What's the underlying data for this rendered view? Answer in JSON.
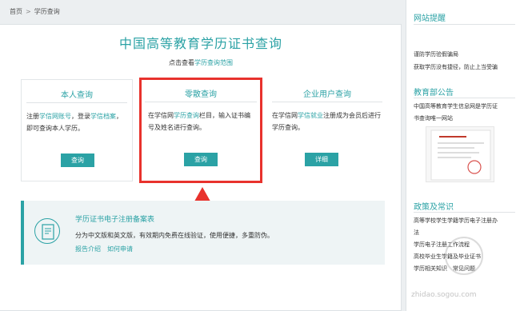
{
  "breadcrumb": {
    "home": "首页",
    "separator": ">",
    "current": "学历查询"
  },
  "main": {
    "title": "中国高等教育学历证书查询",
    "subline_prefix": "点击查看",
    "subline_link": "学历查询范围"
  },
  "cards": [
    {
      "title": "本人查询",
      "desc_parts": [
        "注册",
        "学信网账号",
        "，登录",
        "学信档案",
        "，即可查询本人学历。"
      ],
      "button": "查询"
    },
    {
      "title": "零散查询",
      "desc_parts": [
        "在学信网",
        "学历查询",
        "栏目，输入证书编号及姓名进行查询。"
      ],
      "button": "查询"
    },
    {
      "title": "企业用户查询",
      "desc_parts": [
        "在学信网",
        "学信就业",
        "注册成为会员后进行学历查询。"
      ],
      "button": "详细"
    }
  ],
  "bottom": {
    "title": "学历证书电子注册备案表",
    "desc": "分为中文版和英文版，有效期内免费在线验证，使用便捷，多重防伪。",
    "links": [
      "报告介绍",
      "如何申请"
    ]
  },
  "sidebar": {
    "notice_heading": "网站提醒",
    "notice_items": [
      "谨防学历验假骗局",
      "获取学历没有捷径，防止上当受骗"
    ],
    "announce_heading": "教育部公告",
    "announce_text": [
      "中国高等教育学生信息网是学历证",
      "书查询唯一网站"
    ],
    "policy_heading": "政策及常识",
    "policy_items": [
      "高等学校学生学籍学历电子注册办",
      "法",
      "学历电子注册工作流程",
      "高校毕业生学籍及毕业证书",
      "学历相关知识　常见问题"
    ]
  },
  "watermark": {
    "text": "zhidao.sogou.com"
  },
  "colors": {
    "accent": "#2ba2a5",
    "highlight": "#e8322d"
  }
}
